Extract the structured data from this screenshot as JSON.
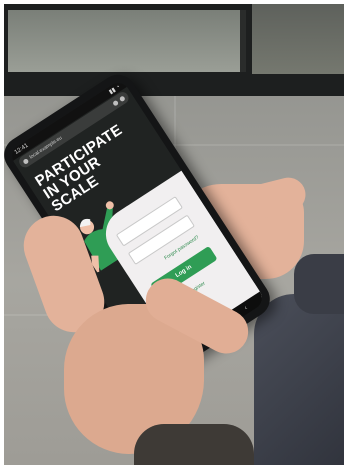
{
  "phone_screen": {
    "status_time": "12:41",
    "url": "local.example.eu",
    "headline": "PARTICIPATE IN YOUR SCALE",
    "login_form": {
      "username_placeholder": "",
      "password_placeholder": "",
      "forgot_link": "Forgot password?",
      "login_button": "Log in",
      "register_link": "Register"
    }
  },
  "colors": {
    "brand_green": "#2f9d55",
    "screen_dark": "#202322",
    "card_bg": "#f1eff0"
  },
  "icons": [
    "home-icon",
    "tabs-icon",
    "menu-icon",
    "back-icon"
  ]
}
